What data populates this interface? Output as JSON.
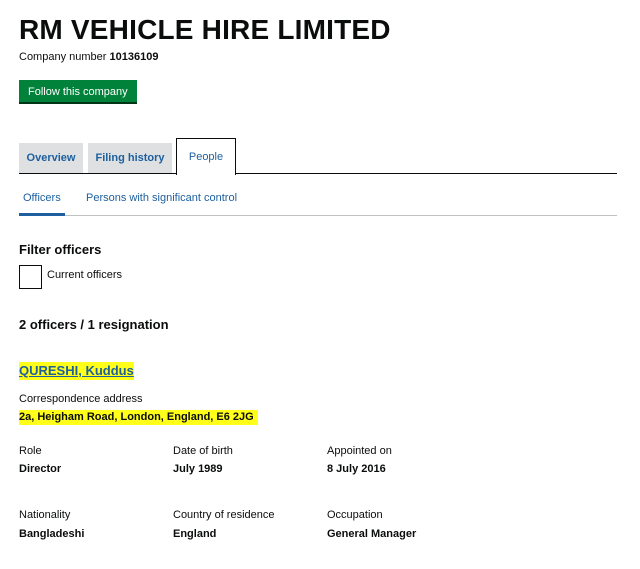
{
  "company": {
    "name": "RM VEHICLE HIRE LIMITED",
    "number_label": "Company number",
    "number": "10136109",
    "follow_label": "Follow this company"
  },
  "tabs": [
    {
      "label": "Overview",
      "active": false
    },
    {
      "label": "Filing history",
      "active": false
    },
    {
      "label": "People",
      "active": true
    }
  ],
  "subnav": [
    {
      "label": "Officers",
      "active": true
    },
    {
      "label": "Persons with significant control",
      "active": false
    }
  ],
  "filter": {
    "heading": "Filter officers",
    "checkbox_label": "Current officers",
    "checked": false
  },
  "officer_count": "2 officers / 1 resignation",
  "officer": {
    "name": "QURESHI, Kuddus",
    "correspondence_label": "Correspondence address",
    "correspondence_address": "2a, Heigham Road, London, England, E6 2JG",
    "fields": {
      "role": {
        "label": "Role",
        "value": "Director"
      },
      "dob": {
        "label": "Date of birth",
        "value": "July 1989"
      },
      "appointed": {
        "label": "Appointed on",
        "value": "8 July 2016"
      },
      "nationality": {
        "label": "Nationality",
        "value": "Bangladeshi"
      },
      "residence": {
        "label": "Country of residence",
        "value": "England"
      },
      "occupation": {
        "label": "Occupation",
        "value": "General Manager"
      }
    }
  },
  "colors": {
    "follow_button": "#00823b",
    "link": "#1d5f9f",
    "highlight": "#ffff1a",
    "tab_inactive_bg": "#dee0e2",
    "text": "#0b0c0c"
  }
}
